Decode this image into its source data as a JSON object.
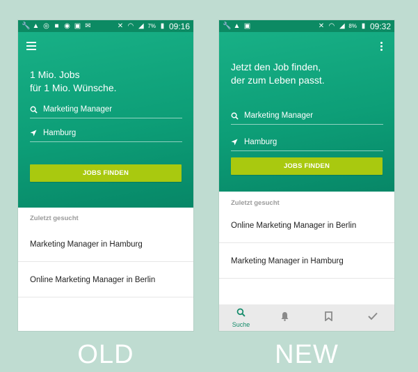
{
  "old": {
    "status": {
      "battery": "7%",
      "time": "09:16"
    },
    "tagline_line1": "1 Mio. Jobs",
    "tagline_line2": "für 1 Mio. Wünsche.",
    "search_value": "Marketing Manager",
    "location_value": "Hamburg",
    "cta_label": "JOBS FINDEN",
    "recent_header": "Zuletzt gesucht",
    "recent": [
      "Marketing Manager in Hamburg",
      "Online Marketing Manager in Berlin"
    ],
    "caption": "OLD"
  },
  "new": {
    "status": {
      "battery": "8%",
      "time": "09:32"
    },
    "tagline_line1": "Jetzt den Job finden,",
    "tagline_line2": "der zum Leben passt.",
    "search_value": "Marketing Manager",
    "location_value": "Hamburg",
    "cta_label": "JOBS FINDEN",
    "recent_header": "Zuletzt gesucht",
    "recent": [
      "Online Marketing Manager in Berlin",
      "Marketing Manager  in Hamburg"
    ],
    "nav": {
      "search_label": "Suche"
    },
    "caption": "NEW"
  },
  "colors": {
    "background": "#bfdcd1",
    "hero": "#0d9e77",
    "cta": "#a9c90f",
    "accent": "#138b6a"
  },
  "icons": [
    "wrench-icon",
    "warning-icon",
    "wifi-icon",
    "signal-icon",
    "battery-icon",
    "menu-icon",
    "overflow-menu-icon",
    "search-icon",
    "location-arrow-icon",
    "bell-icon",
    "bookmark-icon",
    "check-icon"
  ]
}
